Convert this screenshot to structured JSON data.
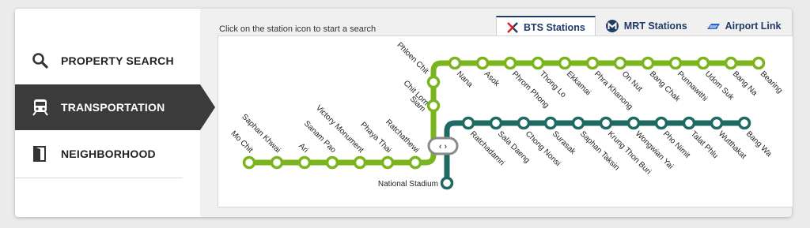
{
  "sidebar": {
    "items": [
      {
        "label": "PROPERTY SEARCH",
        "icon": "search-icon"
      },
      {
        "label": "TRANSPORTATION",
        "icon": "train-icon",
        "active": true
      },
      {
        "label": "NEIGHBORHOOD",
        "icon": "door-icon"
      }
    ]
  },
  "main": {
    "hint": "Click on the station icon to start a search",
    "tabs": [
      {
        "label": "BTS Stations",
        "icon": "bts-logo-icon",
        "active": true
      },
      {
        "label": "MRT Stations",
        "icon": "mrt-logo-icon"
      },
      {
        "label": "Airport Link",
        "icon": "airport-link-icon"
      }
    ]
  },
  "map": {
    "colors": {
      "sukhumvit_line": "#7ab51d",
      "silom_line": "#1e6a63",
      "interchange": "#8a8a8a"
    },
    "interchange_symbol": "‹ ›",
    "sukhumvit_west": [
      "Mo Chit",
      "Saphan Khwai",
      "Ari",
      "Sanam Pao",
      "Victory Monument",
      "Phaya Thai",
      "Ratchathewi"
    ],
    "siam": "Siam",
    "sukhumvit_north": [
      "Chit Lom",
      "Phloen Chit"
    ],
    "sukhumvit_east": [
      "Nana",
      "Asok",
      "Phrom Phong",
      "Thong Lo",
      "Ekkamai",
      "Phra Khanong",
      "On Nut",
      "Bang Chak",
      "Punnawithi",
      "Udom Suk",
      "Bang Na",
      "Bearing"
    ],
    "silom_branch": "National Stadium",
    "silom_east": [
      "Ratchadamri",
      "Sala Daeng",
      "Chong Nonsi",
      "Surasak",
      "Saphan Taksin",
      "Krung Thon Buri",
      "Wongwian Yai",
      "Pho Nimit",
      "Talat Phlu",
      "Wutthakat",
      "Bang Wa"
    ]
  }
}
